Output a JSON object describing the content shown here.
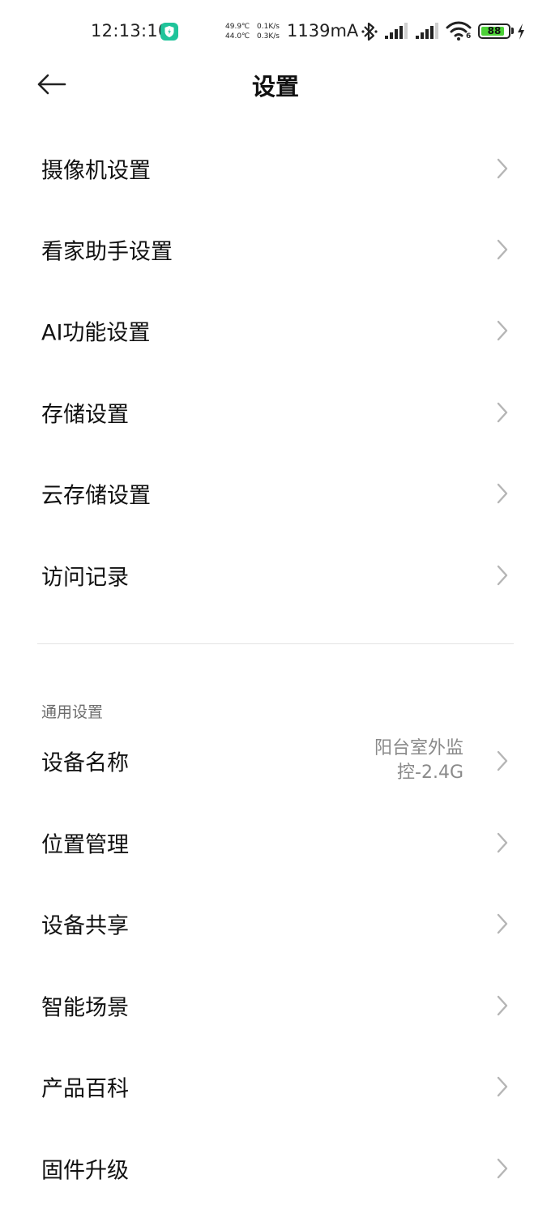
{
  "status_bar": {
    "time": "12:13:10",
    "temp_top": "49.9℃",
    "temp_bottom": "44.0℃",
    "speed_top": "0.1K/s",
    "speed_bottom": "0.3K/s",
    "current": "1139mA",
    "wifi_badge": "6",
    "battery_level": "88",
    "battery_fraction": 0.88,
    "icons": [
      "shield-icon",
      "bluetooth-icon",
      "signal-icon",
      "signal-icon",
      "wifi-icon",
      "battery-icon",
      "charging-icon"
    ],
    "battery_color": "#4cd137",
    "shield_color": "#1fc49a"
  },
  "header": {
    "title": "设置",
    "back_icon": "back-arrow-icon"
  },
  "menu": {
    "items": [
      {
        "label": "摄像机设置"
      },
      {
        "label": "看家助手设置"
      },
      {
        "label": "AI功能设置"
      },
      {
        "label": "存储设置"
      },
      {
        "label": "云存储设置"
      },
      {
        "label": "访问记录"
      }
    ]
  },
  "general": {
    "title": "通用设置",
    "items": [
      {
        "label": "设备名称",
        "value_line1": "阳台室外监",
        "value_line2": "控-2.4G"
      },
      {
        "label": "位置管理"
      },
      {
        "label": "设备共享"
      },
      {
        "label": "智能场景"
      },
      {
        "label": "产品百科"
      },
      {
        "label": "固件升级"
      }
    ]
  },
  "colors": {
    "text_primary": "#111111",
    "text_secondary": "#8a8a8a",
    "chevron": "#b5b5b5",
    "divider": "#e3e3e3"
  }
}
